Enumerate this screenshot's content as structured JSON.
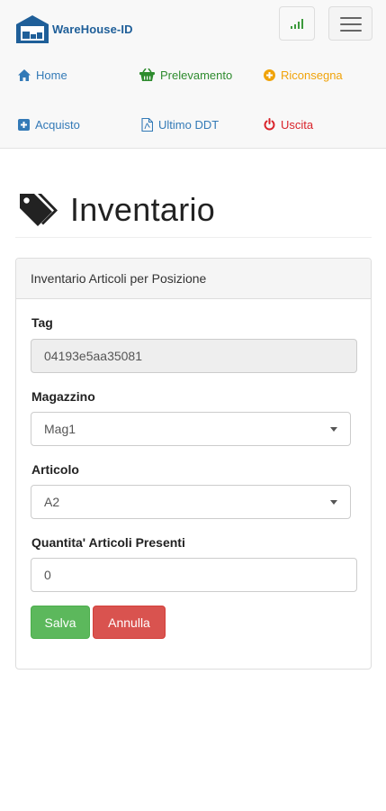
{
  "app": {
    "brand": "WareHouse-ID"
  },
  "nav": {
    "home": "Home",
    "picking": "Prelevamento",
    "return": "Riconsegna",
    "purchase": "Acquisto",
    "last_ddt": "Ultimo DDT",
    "exit": "Uscita"
  },
  "colors": {
    "brand": "#1f5f99",
    "nav_link": "#337ab7",
    "picking": "#2e8b2e",
    "return": "#f0a30a",
    "exit": "#d9232a",
    "save": "#5cb85c",
    "cancel": "#d9534f"
  },
  "icons": {
    "home": "home-icon",
    "picking": "basket-icon",
    "return": "plus-circle-icon",
    "purchase": "plus-square-icon",
    "last_ddt": "pdf-file-icon",
    "exit": "power-icon",
    "title": "tags-icon",
    "signal": "signal-icon",
    "menu": "hamburger-menu-icon"
  },
  "page": {
    "title": "Inventario"
  },
  "panel": {
    "heading": "Inventario Articoli per Posizione",
    "tag_label": "Tag",
    "tag_value": "04193e5aa35081",
    "warehouse_label": "Magazzino",
    "warehouse_value": "Mag1",
    "article_label": "Articolo",
    "article_value": "A2",
    "quantity_label": "Quantita' Articoli Presenti",
    "quantity_value": "0",
    "save_label": "Salva",
    "cancel_label": "Annulla"
  }
}
